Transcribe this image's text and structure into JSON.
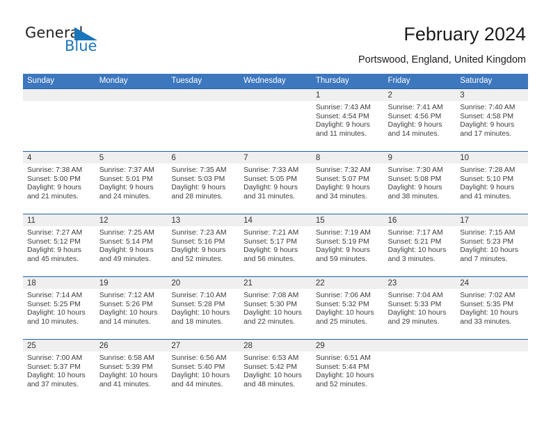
{
  "brand": {
    "name_part1": "General",
    "name_part2": "Blue",
    "triangle_icon": "triangle-icon",
    "color_dark": "#231f20",
    "color_blue": "#1b75bb"
  },
  "header": {
    "title": "February 2024",
    "subtitle": "Portswood, England, United Kingdom",
    "accent_color": "#3d77be",
    "row_border_color": "#1f5fa8",
    "day_header_bg": "#efefef"
  },
  "calendar": {
    "weekdays": [
      "Sunday",
      "Monday",
      "Tuesday",
      "Wednesday",
      "Thursday",
      "Friday",
      "Saturday"
    ],
    "weeks": [
      [
        {
          "date": "",
          "sunrise": "",
          "sunset": "",
          "daylight_line1": "",
          "daylight_line2": ""
        },
        {
          "date": "",
          "sunrise": "",
          "sunset": "",
          "daylight_line1": "",
          "daylight_line2": ""
        },
        {
          "date": "",
          "sunrise": "",
          "sunset": "",
          "daylight_line1": "",
          "daylight_line2": ""
        },
        {
          "date": "",
          "sunrise": "",
          "sunset": "",
          "daylight_line1": "",
          "daylight_line2": ""
        },
        {
          "date": "1",
          "sunrise": "Sunrise: 7:43 AM",
          "sunset": "Sunset: 4:54 PM",
          "daylight_line1": "Daylight: 9 hours",
          "daylight_line2": "and 11 minutes."
        },
        {
          "date": "2",
          "sunrise": "Sunrise: 7:41 AM",
          "sunset": "Sunset: 4:56 PM",
          "daylight_line1": "Daylight: 9 hours",
          "daylight_line2": "and 14 minutes."
        },
        {
          "date": "3",
          "sunrise": "Sunrise: 7:40 AM",
          "sunset": "Sunset: 4:58 PM",
          "daylight_line1": "Daylight: 9 hours",
          "daylight_line2": "and 17 minutes."
        }
      ],
      [
        {
          "date": "4",
          "sunrise": "Sunrise: 7:38 AM",
          "sunset": "Sunset: 5:00 PM",
          "daylight_line1": "Daylight: 9 hours",
          "daylight_line2": "and 21 minutes."
        },
        {
          "date": "5",
          "sunrise": "Sunrise: 7:37 AM",
          "sunset": "Sunset: 5:01 PM",
          "daylight_line1": "Daylight: 9 hours",
          "daylight_line2": "and 24 minutes."
        },
        {
          "date": "6",
          "sunrise": "Sunrise: 7:35 AM",
          "sunset": "Sunset: 5:03 PM",
          "daylight_line1": "Daylight: 9 hours",
          "daylight_line2": "and 28 minutes."
        },
        {
          "date": "7",
          "sunrise": "Sunrise: 7:33 AM",
          "sunset": "Sunset: 5:05 PM",
          "daylight_line1": "Daylight: 9 hours",
          "daylight_line2": "and 31 minutes."
        },
        {
          "date": "8",
          "sunrise": "Sunrise: 7:32 AM",
          "sunset": "Sunset: 5:07 PM",
          "daylight_line1": "Daylight: 9 hours",
          "daylight_line2": "and 34 minutes."
        },
        {
          "date": "9",
          "sunrise": "Sunrise: 7:30 AM",
          "sunset": "Sunset: 5:08 PM",
          "daylight_line1": "Daylight: 9 hours",
          "daylight_line2": "and 38 minutes."
        },
        {
          "date": "10",
          "sunrise": "Sunrise: 7:28 AM",
          "sunset": "Sunset: 5:10 PM",
          "daylight_line1": "Daylight: 9 hours",
          "daylight_line2": "and 41 minutes."
        }
      ],
      [
        {
          "date": "11",
          "sunrise": "Sunrise: 7:27 AM",
          "sunset": "Sunset: 5:12 PM",
          "daylight_line1": "Daylight: 9 hours",
          "daylight_line2": "and 45 minutes."
        },
        {
          "date": "12",
          "sunrise": "Sunrise: 7:25 AM",
          "sunset": "Sunset: 5:14 PM",
          "daylight_line1": "Daylight: 9 hours",
          "daylight_line2": "and 49 minutes."
        },
        {
          "date": "13",
          "sunrise": "Sunrise: 7:23 AM",
          "sunset": "Sunset: 5:16 PM",
          "daylight_line1": "Daylight: 9 hours",
          "daylight_line2": "and 52 minutes."
        },
        {
          "date": "14",
          "sunrise": "Sunrise: 7:21 AM",
          "sunset": "Sunset: 5:17 PM",
          "daylight_line1": "Daylight: 9 hours",
          "daylight_line2": "and 56 minutes."
        },
        {
          "date": "15",
          "sunrise": "Sunrise: 7:19 AM",
          "sunset": "Sunset: 5:19 PM",
          "daylight_line1": "Daylight: 9 hours",
          "daylight_line2": "and 59 minutes."
        },
        {
          "date": "16",
          "sunrise": "Sunrise: 7:17 AM",
          "sunset": "Sunset: 5:21 PM",
          "daylight_line1": "Daylight: 10 hours",
          "daylight_line2": "and 3 minutes."
        },
        {
          "date": "17",
          "sunrise": "Sunrise: 7:15 AM",
          "sunset": "Sunset: 5:23 PM",
          "daylight_line1": "Daylight: 10 hours",
          "daylight_line2": "and 7 minutes."
        }
      ],
      [
        {
          "date": "18",
          "sunrise": "Sunrise: 7:14 AM",
          "sunset": "Sunset: 5:25 PM",
          "daylight_line1": "Daylight: 10 hours",
          "daylight_line2": "and 10 minutes."
        },
        {
          "date": "19",
          "sunrise": "Sunrise: 7:12 AM",
          "sunset": "Sunset: 5:26 PM",
          "daylight_line1": "Daylight: 10 hours",
          "daylight_line2": "and 14 minutes."
        },
        {
          "date": "20",
          "sunrise": "Sunrise: 7:10 AM",
          "sunset": "Sunset: 5:28 PM",
          "daylight_line1": "Daylight: 10 hours",
          "daylight_line2": "and 18 minutes."
        },
        {
          "date": "21",
          "sunrise": "Sunrise: 7:08 AM",
          "sunset": "Sunset: 5:30 PM",
          "daylight_line1": "Daylight: 10 hours",
          "daylight_line2": "and 22 minutes."
        },
        {
          "date": "22",
          "sunrise": "Sunrise: 7:06 AM",
          "sunset": "Sunset: 5:32 PM",
          "daylight_line1": "Daylight: 10 hours",
          "daylight_line2": "and 25 minutes."
        },
        {
          "date": "23",
          "sunrise": "Sunrise: 7:04 AM",
          "sunset": "Sunset: 5:33 PM",
          "daylight_line1": "Daylight: 10 hours",
          "daylight_line2": "and 29 minutes."
        },
        {
          "date": "24",
          "sunrise": "Sunrise: 7:02 AM",
          "sunset": "Sunset: 5:35 PM",
          "daylight_line1": "Daylight: 10 hours",
          "daylight_line2": "and 33 minutes."
        }
      ],
      [
        {
          "date": "25",
          "sunrise": "Sunrise: 7:00 AM",
          "sunset": "Sunset: 5:37 PM",
          "daylight_line1": "Daylight: 10 hours",
          "daylight_line2": "and 37 minutes."
        },
        {
          "date": "26",
          "sunrise": "Sunrise: 6:58 AM",
          "sunset": "Sunset: 5:39 PM",
          "daylight_line1": "Daylight: 10 hours",
          "daylight_line2": "and 41 minutes."
        },
        {
          "date": "27",
          "sunrise": "Sunrise: 6:56 AM",
          "sunset": "Sunset: 5:40 PM",
          "daylight_line1": "Daylight: 10 hours",
          "daylight_line2": "and 44 minutes."
        },
        {
          "date": "28",
          "sunrise": "Sunrise: 6:53 AM",
          "sunset": "Sunset: 5:42 PM",
          "daylight_line1": "Daylight: 10 hours",
          "daylight_line2": "and 48 minutes."
        },
        {
          "date": "29",
          "sunrise": "Sunrise: 6:51 AM",
          "sunset": "Sunset: 5:44 PM",
          "daylight_line1": "Daylight: 10 hours",
          "daylight_line2": "and 52 minutes."
        },
        {
          "date": "",
          "sunrise": "",
          "sunset": "",
          "daylight_line1": "",
          "daylight_line2": ""
        },
        {
          "date": "",
          "sunrise": "",
          "sunset": "",
          "daylight_line1": "",
          "daylight_line2": ""
        }
      ]
    ]
  }
}
